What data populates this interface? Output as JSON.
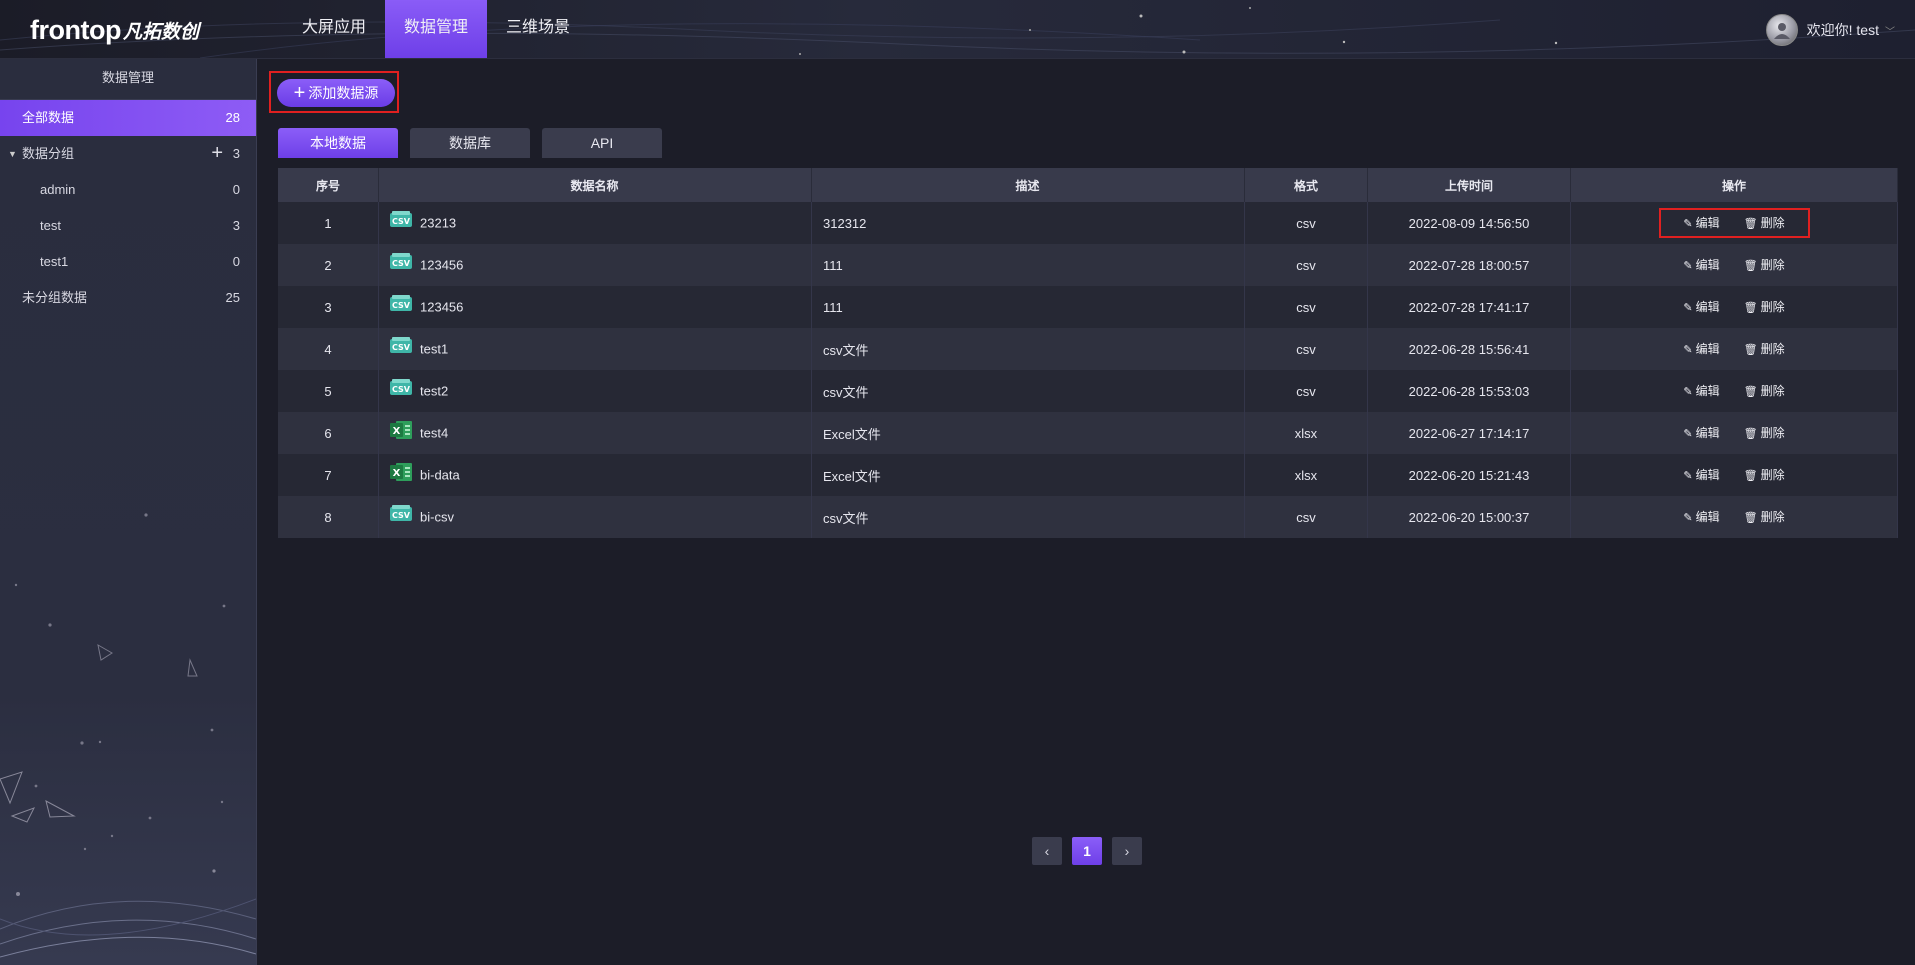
{
  "header": {
    "logo_latin": "frontop",
    "logo_cn": "凡拓数创",
    "nav": [
      {
        "label": "大屏应用",
        "active": false
      },
      {
        "label": "数据管理",
        "active": true
      },
      {
        "label": "三维场景",
        "active": false
      }
    ],
    "welcome": "欢迎你! test"
  },
  "sidebar": {
    "title": "数据管理",
    "all": {
      "label": "全部数据",
      "count": "28"
    },
    "groups": {
      "label": "数据分组",
      "count": "3"
    },
    "children": [
      {
        "label": "admin",
        "count": "0"
      },
      {
        "label": "test",
        "count": "3"
      },
      {
        "label": "test1",
        "count": "0"
      }
    ],
    "ungrouped": {
      "label": "未分组数据",
      "count": "25"
    }
  },
  "main": {
    "add_button": "添加数据源",
    "tabs": [
      {
        "label": "本地数据",
        "active": true
      },
      {
        "label": "数据库",
        "active": false
      },
      {
        "label": "API",
        "active": false
      }
    ],
    "table": {
      "headers": [
        "序号",
        "数据名称",
        "描述",
        "格式",
        "上传时间",
        "操作"
      ],
      "rows": [
        {
          "idx": "1",
          "icon": "csv-file-icon",
          "name": "23213",
          "desc": "312312",
          "fmt": "csv",
          "time": "2022-08-09 14:56:50"
        },
        {
          "idx": "2",
          "icon": "csv-file-icon",
          "name": "123456",
          "desc": "111",
          "fmt": "csv",
          "time": "2022-07-28 18:00:57"
        },
        {
          "idx": "3",
          "icon": "csv-file-icon",
          "name": "123456",
          "desc": "111",
          "fmt": "csv",
          "time": "2022-07-28 17:41:17"
        },
        {
          "idx": "4",
          "icon": "csv-file-icon",
          "name": "test1",
          "desc": "csv文件",
          "fmt": "csv",
          "time": "2022-06-28 15:56:41"
        },
        {
          "idx": "5",
          "icon": "csv-file-icon",
          "name": "test2",
          "desc": "csv文件",
          "fmt": "csv",
          "time": "2022-06-28 15:53:03"
        },
        {
          "idx": "6",
          "icon": "excel-file-icon",
          "name": "test4",
          "desc": "Excel文件",
          "fmt": "xlsx",
          "time": "2022-06-27 17:14:17"
        },
        {
          "idx": "7",
          "icon": "excel-file-icon",
          "name": "bi-data",
          "desc": "Excel文件",
          "fmt": "xlsx",
          "time": "2022-06-20 15:21:43"
        },
        {
          "idx": "8",
          "icon": "csv-file-icon",
          "name": "bi-csv",
          "desc": "csv文件",
          "fmt": "csv",
          "time": "2022-06-20 15:00:37"
        }
      ],
      "edit_label": "编辑",
      "delete_label": "删除"
    },
    "pager": {
      "prev": "‹",
      "current": "1",
      "next": "›"
    }
  },
  "colors": {
    "accent": "#7744ee",
    "highlight_border": "#e02020",
    "background": "#1c1d28"
  }
}
